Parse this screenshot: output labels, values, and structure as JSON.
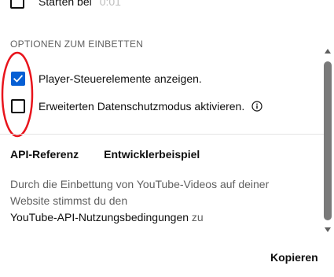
{
  "start_row": {
    "label": "Starten bei",
    "value": "0:01",
    "checked": false
  },
  "embed_options": {
    "title": "OPTIONEN ZUM EINBETTEN",
    "items": [
      {
        "label": "Player-Steuerelemente anzeigen.",
        "checked": true
      },
      {
        "label": "Erweiterten Datenschutzmodus aktivieren.",
        "checked": false,
        "icon": "info-icon"
      }
    ]
  },
  "links": {
    "api_reference": "API-Referenz",
    "developer_example": "Entwicklerbeispiel"
  },
  "description": {
    "text": "Durch die Einbettung von YouTube-Videos auf deiner Website stimmst du den",
    "tos_link": "YouTube-API-Nutzungsbedingungen",
    "suffix": " zu"
  },
  "actions": {
    "copy_label": "Kopieren"
  },
  "colors": {
    "accent": "#065fd4",
    "annotation": "#e8141c"
  }
}
